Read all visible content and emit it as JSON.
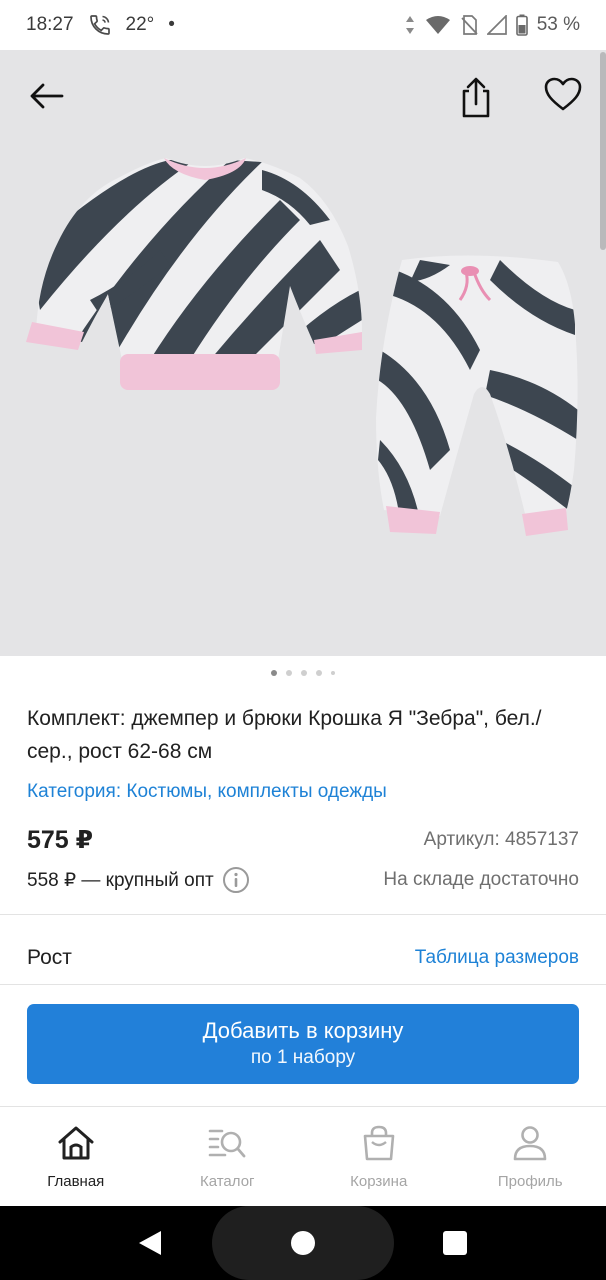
{
  "status_bar": {
    "time": "18:27",
    "temperature": "22°",
    "dot": "•",
    "battery": "53 %",
    "icons": [
      "phone-call-icon",
      "data-arrows-icon",
      "wifi-icon",
      "no-sim-icon",
      "signal-icon",
      "battery-icon"
    ]
  },
  "hero": {
    "icons": [
      "back-arrow-icon",
      "share-icon",
      "heart-icon"
    ],
    "gallery_dots": 5,
    "active_dot": 0,
    "colors": {
      "background": "#e4e4e6",
      "fabric_dark": "#3d4650",
      "fabric_light": "#efeff1",
      "cuff_pink": "#f1c4d8"
    }
  },
  "product": {
    "title": "Комплект: джемпер и брюки Крошка Я \"Зебра\", бел./сер., рост 62-68 см",
    "category": "Категория: Костюмы, комплекты одежды",
    "price": "575 ₽",
    "article": "Артикул: 4857137",
    "wholesale": "558 ₽ — крупный опт",
    "stock": "На складе достаточно"
  },
  "size": {
    "label": "Рост",
    "table_link": "Таблица размеров"
  },
  "cta": {
    "main": "Добавить в корзину",
    "sub": "по 1 набору",
    "color": "#2280d9"
  },
  "tabs": [
    {
      "label": "Главная",
      "icon": "home-icon",
      "active": true
    },
    {
      "label": "Каталог",
      "icon": "catalog-search-icon",
      "active": false
    },
    {
      "label": "Корзина",
      "icon": "cart-bag-icon",
      "active": false
    },
    {
      "label": "Профиль",
      "icon": "profile-icon",
      "active": false
    }
  ],
  "nav": {
    "icons": [
      "nav-back-icon",
      "nav-home-icon",
      "nav-recents-icon"
    ]
  },
  "accent_color": "#1e82d6"
}
